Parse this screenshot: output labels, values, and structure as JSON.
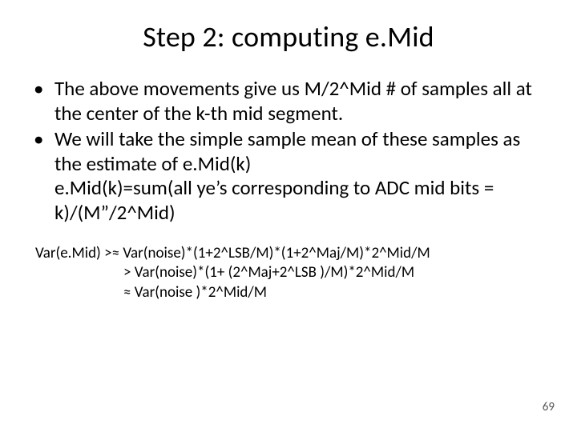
{
  "title": "Step 2: computing e.Mid",
  "bullets": [
    {
      "text": "The above movements give us M/2^Mid # of samples all at the center of the k-th mid segment."
    },
    {
      "text": "We will take the simple sample mean of these samples as the estimate of e.Mid(k)",
      "sub": "e.Mid(k)=sum(all ye’s corresponding to ADC mid bits = k)/(M”/2^Mid)"
    }
  ],
  "variance": {
    "line1": "Var(e.Mid) >≈ Var(noise)*(1+2^LSB/M)*(1+2^Maj/M)*2^Mid/M",
    "line2": "> Var(noise)*(1+ (2^Maj+2^LSB )/M)*2^Mid/M",
    "line3": "≈ Var(noise )*2^Mid/M"
  },
  "page_number": "69"
}
